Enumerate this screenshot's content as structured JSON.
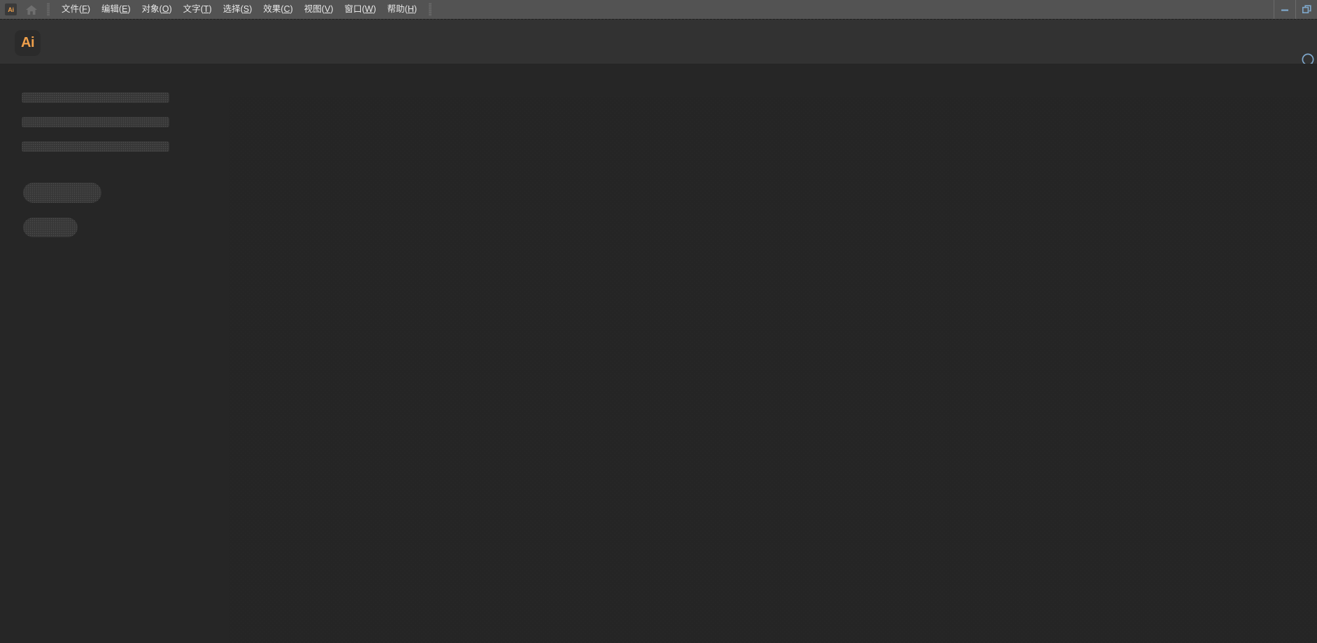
{
  "window": {
    "app_badge": "Ai",
    "home_icon": "home-icon",
    "drag_handle_icon": "dotted-drag-handle-icon",
    "controls": [
      {
        "name": "minimize-button",
        "icon": "minimize-icon"
      },
      {
        "name": "restore-button",
        "icon": "restore-window-icon"
      }
    ]
  },
  "menubar": {
    "items": [
      {
        "label": "文件(F)",
        "text": "文件(",
        "accel": "F",
        "tail": ")"
      },
      {
        "label": "编辑(E)",
        "text": "编辑(",
        "accel": "E",
        "tail": ")"
      },
      {
        "label": "对象(O)",
        "text": "对象(",
        "accel": "O",
        "tail": ")"
      },
      {
        "label": "文字(T)",
        "text": "文字(",
        "accel": "T",
        "tail": ")"
      },
      {
        "label": "选择(S)",
        "text": "选择(",
        "accel": "S",
        "tail": ")"
      },
      {
        "label": "效果(C)",
        "text": "效果(",
        "accel": "C",
        "tail": ")"
      },
      {
        "label": "视图(V)",
        "text": "视图(",
        "accel": "V",
        "tail": ")"
      },
      {
        "label": "窗口(W)",
        "text": "窗口(",
        "accel": "W",
        "tail": ")"
      },
      {
        "label": "帮助(H)",
        "text": "帮助(",
        "accel": "H",
        "tail": ")"
      }
    ]
  },
  "header": {
    "logo_text": "Ai",
    "search_icon": "search-icon"
  },
  "home_screen": {
    "state": "loading",
    "skeleton_lines": [
      {
        "name": "skeleton-line-1"
      },
      {
        "name": "skeleton-line-2"
      },
      {
        "name": "skeleton-line-3"
      }
    ],
    "skeleton_pills": [
      {
        "name": "skeleton-pill-1"
      },
      {
        "name": "skeleton-pill-2"
      }
    ],
    "canvas_placeholder": "loading-content-area"
  },
  "colors": {
    "titlebar_bg": "#535353",
    "header_bg": "#323232",
    "body_bg": "#262626",
    "canvas_bg": "#252525",
    "skeleton": "#3a3a3a",
    "accent_orange": "#f0a04b",
    "control_blue": "#7fa8cc",
    "menu_text": "#e9e9e9"
  }
}
